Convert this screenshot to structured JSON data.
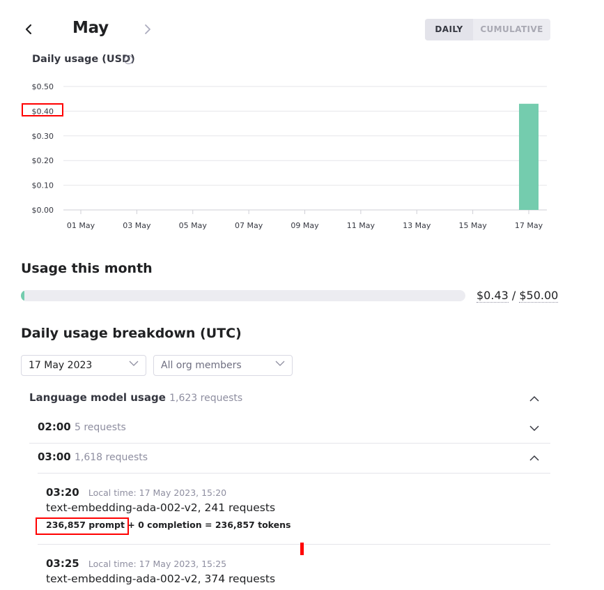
{
  "header": {
    "month": "May",
    "prev_icon": "chevron-left-icon",
    "next_icon": "chevron-right-icon",
    "toggle": {
      "daily": "DAILY",
      "cumulative": "CUMULATIVE",
      "selected": "DAILY"
    }
  },
  "chart_title": "Daily usage (USD)",
  "info_glyph": "i",
  "chart_data": {
    "type": "bar",
    "title": "Daily usage (USD)",
    "y_ticks": [
      "$0.00",
      "$0.10",
      "$0.20",
      "$0.30",
      "$0.40",
      "$0.50"
    ],
    "x_ticks": [
      "01 May",
      "03 May",
      "05 May",
      "07 May",
      "09 May",
      "11 May",
      "13 May",
      "15 May",
      "17 May"
    ],
    "ylim": [
      0,
      0.5
    ],
    "grid": true,
    "color": "#74ccae",
    "bars": [
      {
        "date": "17 May",
        "value": 0.43
      }
    ]
  },
  "usage_month": {
    "title": "Usage this month",
    "fraction": 0.0086,
    "used": "$0.43",
    "separator": " / ",
    "limit": "$50.00"
  },
  "breakdown": {
    "title": "Daily usage breakdown (UTC)",
    "date_select": "17 May 2023",
    "members_select": "All org members",
    "section": {
      "title": "Language model usage",
      "count": "1,623 requests"
    },
    "hours": [
      {
        "time": "02:00",
        "count": "5 requests",
        "expanded": false
      },
      {
        "time": "03:00",
        "count": "1,618 requests",
        "expanded": true
      }
    ],
    "entries": [
      {
        "time": "03:20",
        "local": "Local time: 17 May 2023, 15:20",
        "model": "text-embedding-ada-002-v2, 241 requests",
        "tokens": "236,857 prompt + 0 completion = 236,857 tokens"
      },
      {
        "time": "03:25",
        "local": "Local time: 17 May 2023, 15:25",
        "model": "text-embedding-ada-002-v2, 374 requests"
      }
    ]
  }
}
